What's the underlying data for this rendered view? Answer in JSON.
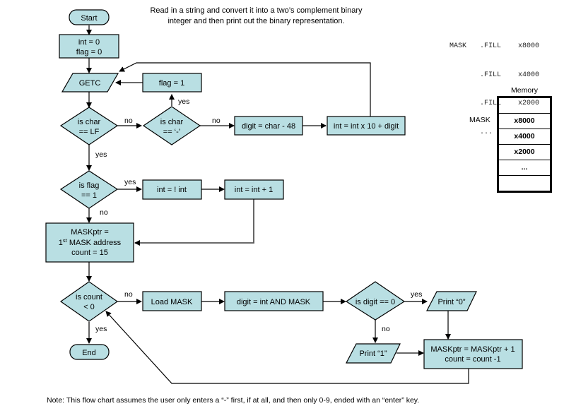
{
  "title": {
    "line1": "Read in a string and convert it into a two’s complement binary",
    "line2": "integer and then print out the binary representation."
  },
  "assembly": [
    {
      "label": "MASK",
      "op": ".FILL",
      "value": "x8000"
    },
    {
      "label": "",
      "op": ".FILL",
      "value": "x4000"
    },
    {
      "label": "",
      "op": ".FILL",
      "value": "x2000"
    },
    {
      "label": "",
      "op": "...",
      "value": ""
    }
  ],
  "memory": {
    "title": "Memory",
    "pointer_label": "MASK",
    "cells": [
      "",
      "x8000",
      "x4000",
      "x2000",
      "...",
      ""
    ]
  },
  "nodes": {
    "start": "Start",
    "init_1": "int = 0",
    "init_2": "flag = 0",
    "getc": "GETC",
    "flag_set": "flag = 1",
    "is_lf_1": "is char",
    "is_lf_2": "== LF",
    "is_minus_1": "is char",
    "is_minus_2": "== ‘-’",
    "digit_calc": "digit = char - 48",
    "int_accum": "int = int x 10 + digit",
    "is_flag_1": "is flag",
    "is_flag_2": "== 1",
    "int_not": "int = ! int",
    "int_inc": "int = int + 1",
    "maskptr_1": "MASKptr =",
    "maskptr_2a": "1",
    "maskptr_2sup": "st",
    "maskptr_2b": " MASK address",
    "maskptr_3": "count = 15",
    "is_count_1": "is count",
    "is_count_2": "< 0",
    "load_mask": "Load MASK",
    "digit_and": "digit = int AND MASK",
    "is_digit_zero": "is digit == 0",
    "print_0": "Print “0”",
    "print_1": "Print “1”",
    "update_1": "MASKptr = MASKptr + 1",
    "update_2": "count = count -1",
    "end": "End"
  },
  "edge_labels": {
    "minus_yes": "yes",
    "lf_no": "no",
    "minus_no": "no",
    "lf_yes": "yes",
    "flag_yes": "yes",
    "flag_no": "no",
    "count_no": "no",
    "count_yes": "yes",
    "digit_yes": "yes",
    "digit_no": "no"
  },
  "note": "Note:  This flow chart assumes the user only enters a “-” first, if at all, and then only 0-9, ended with an “enter” key."
}
